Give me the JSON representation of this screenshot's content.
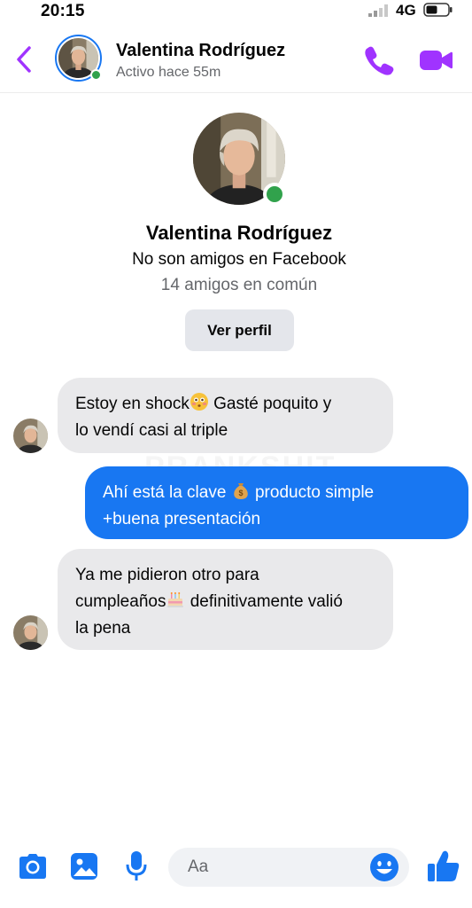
{
  "status_bar": {
    "time": "20:15",
    "network": "4G"
  },
  "header": {
    "contact_name": "Valentina Rodríguez",
    "activity": "Activo hace 55m"
  },
  "profile": {
    "name": "Valentina Rodríguez",
    "relationship": "No son amigos en Facebook",
    "mutual_friends": "14 amigos en común",
    "view_profile_label": "Ver perfil"
  },
  "watermark": "PRANKSHIT",
  "messages": [
    {
      "direction": "incoming",
      "line1_before": "Estoy en shock",
      "emoji1": "flushed-face",
      "line1_after": "Gasté poquito y",
      "line2": "lo vendí casi al triple"
    },
    {
      "direction": "outgoing",
      "line1_before": "Ahí está la clave",
      "emoji1": "money-bag",
      "line1_after": "producto simple",
      "line2": "+buena presentación"
    },
    {
      "direction": "incoming",
      "line1": "Ya me pidieron otro para",
      "line2_before": "cumpleaños",
      "emoji1": "birthday-cake",
      "line2_after": "definitivamente valió",
      "line3": "la pena"
    }
  ],
  "composer": {
    "placeholder": "Aa"
  },
  "colors": {
    "accent": "#a033ff",
    "brand_blue": "#1877f2",
    "online": "#31a24c",
    "incoming_bubble": "#e9e9eb"
  },
  "icons": [
    "back-chevron-icon",
    "phone-icon",
    "video-camera-icon",
    "camera-icon",
    "photo-gallery-icon",
    "microphone-icon",
    "smiley-icon",
    "thumbs-up-icon"
  ]
}
